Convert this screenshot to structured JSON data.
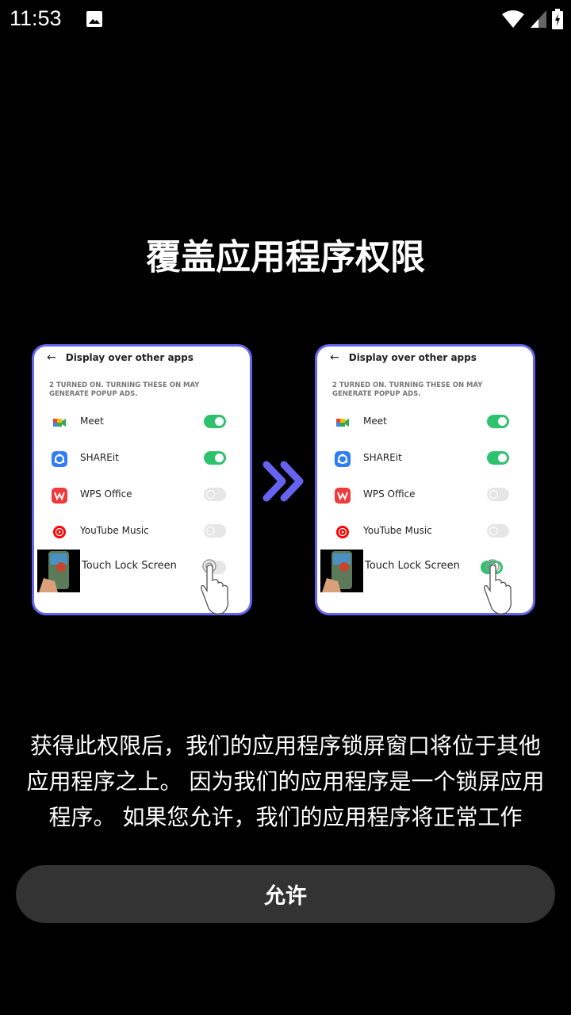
{
  "status_bar": {
    "time": "11:53",
    "left_icons": [
      "image-notification-icon"
    ],
    "right_icons": [
      "wifi-icon",
      "cellular-signal-icon",
      "battery-charging-icon"
    ]
  },
  "page": {
    "title": "覆盖应用程序权限",
    "description": "获得此权限后，我们的应用程序锁屏窗口将位于其他应用程序之上。 因为我们的应用程序是一个锁屏应用程序。 如果您允许，我们的应用程序将正常工作",
    "allow_button": "允许"
  },
  "illustration": {
    "colors": {
      "accent": "#6563f0",
      "toggle_on": "#2ec26e",
      "toggle_off": "#e6e6e6"
    },
    "before": {
      "header": "Display over other apps",
      "note": "2 TURNED ON. TURNING THESE ON MAY GENERATE POPUP ADS.",
      "apps": [
        {
          "name": "Meet",
          "icon": "meet-icon",
          "enabled": true
        },
        {
          "name": "SHAREit",
          "icon": "shareit-icon",
          "enabled": true
        },
        {
          "name": "WPS Office",
          "icon": "wps-office-icon",
          "enabled": false
        },
        {
          "name": "YouTube Music",
          "icon": "youtube-music-icon",
          "enabled": false
        },
        {
          "name": "Touch Lock Screen",
          "icon": "touch-lock-screen-thumbnail",
          "enabled": false
        }
      ]
    },
    "arrow_icon": "double-chevron-right-icon",
    "after": {
      "header": "Display over other apps",
      "note": "2 TURNED ON. TURNING THESE ON MAY GENERATE POPUP ADS.",
      "apps": [
        {
          "name": "Meet",
          "icon": "meet-icon",
          "enabled": true
        },
        {
          "name": "SHAREit",
          "icon": "shareit-icon",
          "enabled": true
        },
        {
          "name": "WPS Office",
          "icon": "wps-office-icon",
          "enabled": false
        },
        {
          "name": "YouTube Music",
          "icon": "youtube-music-icon",
          "enabled": false
        },
        {
          "name": "Touch Lock Screen",
          "icon": "touch-lock-screen-thumbnail",
          "enabled": true
        }
      ]
    }
  }
}
